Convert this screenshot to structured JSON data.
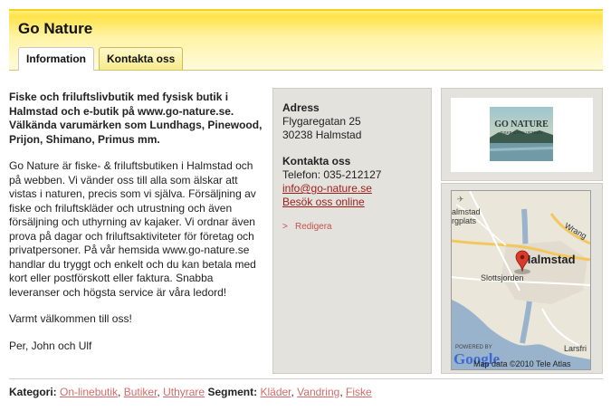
{
  "header": {
    "title": "Go Nature",
    "tabs": [
      {
        "label": "Information",
        "active": true
      },
      {
        "label": "Kontakta oss",
        "active": false
      }
    ]
  },
  "description": {
    "lead": "Fiske och friluftslivbutik med fysisk butik i Halmstad och e-butik på www.go-nature.se. Välkända varumärken som Lundhags, Pinewood, Prijon, Shimano, Primus mm.",
    "body": "Go Nature är fiske- & friluftsbutiken i Halmstad och på webben. Vi vänder oss till alla som älskar att vistas i naturen, precis som vi själva. Försäljning av fiske och friluftskläder och utrustning och även försäljning och uthyrning av kajaker. Vi ordnar även prova på dagar och friluftsaktiviteter för företag och privatpersoner. På vår hemsida www.go-nature.se handlar du tryggt och enkelt och du kan betala med kort eller postförskott eller faktura. Snabba leveranser och högsta service är våra ledord!",
    "welcome": "Varmt välkommen till oss!",
    "signature": "Per, John och Ulf"
  },
  "contact": {
    "address_heading": "Adress",
    "street": "Flygaregatan 25",
    "postal": "30238 Halmstad",
    "contact_heading": "Kontakta oss",
    "phone": "Telefon: 035-212127",
    "email": "info@go-nature.se",
    "visit_link": "Besök oss online",
    "edit_label": "Redigera"
  },
  "logo": {
    "text": "GO NATURE",
    "subtext": "FISKE & FRILUFTSLIV"
  },
  "map": {
    "city_label": "Halmstad",
    "labels": [
      "almstad",
      "rgplats",
      "Slottsjorden",
      "Wrang",
      "Larsfri"
    ],
    "powered_by": "POWERED BY",
    "google": "Google",
    "copyright": "Map data ©2010 Tele Atlas",
    "marker_color": "#d93a2b"
  },
  "footer": {
    "category_label": "Kategori:",
    "categories": [
      "On-linebutik",
      "Butiker",
      "Uthyrare"
    ],
    "segment_label": "Segment:",
    "segments": [
      "Kläder",
      "Vandring",
      "Fiske"
    ]
  }
}
